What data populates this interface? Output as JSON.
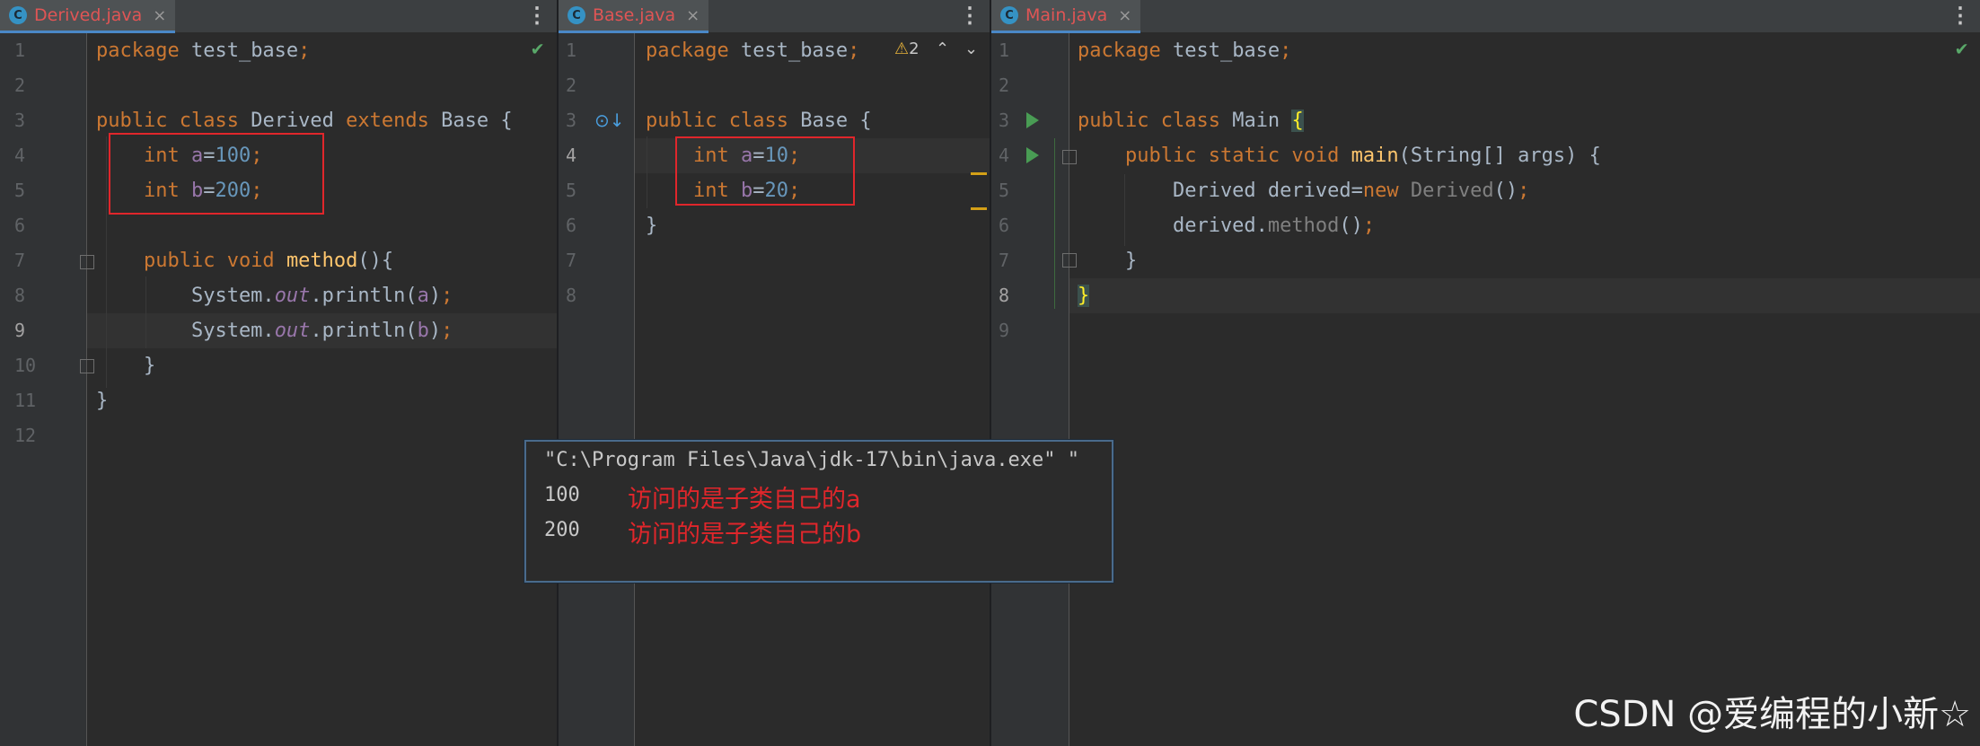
{
  "panes": {
    "derived": {
      "tab_label": "Derived.java",
      "tab_icon": "C",
      "line_numbers": [
        "1",
        "2",
        "3",
        "4",
        "5",
        "6",
        "7",
        "8",
        "9",
        "10",
        "11",
        "12"
      ]
    },
    "base": {
      "tab_label": "Base.java",
      "tab_icon": "C",
      "line_numbers": [
        "1",
        "2",
        "3",
        "4",
        "5",
        "6",
        "7",
        "8"
      ],
      "warning_count": "2"
    },
    "main": {
      "tab_label": "Main.java",
      "tab_icon": "C",
      "line_numbers": [
        "1",
        "2",
        "3",
        "4",
        "5",
        "6",
        "7",
        "8",
        "9"
      ]
    }
  },
  "tab_close_glyph": "×",
  "menu_glyph": "⋮",
  "console": {
    "command": "\"C:\\Program Files\\Java\\jdk-17\\bin\\java.exe\" \"",
    "outputs": [
      "100",
      "200"
    ],
    "notes": [
      "访问的是子类自己的a",
      "访问的是子类自己的b"
    ]
  },
  "watermark": "CSDN @爱编程的小新☆",
  "colors": {
    "keyword": "#cc7832",
    "number": "#6897bb",
    "field": "#9876aa",
    "method": "#ffc66d",
    "highlight_box": "#e0262b",
    "run_icon": "#499c54"
  }
}
